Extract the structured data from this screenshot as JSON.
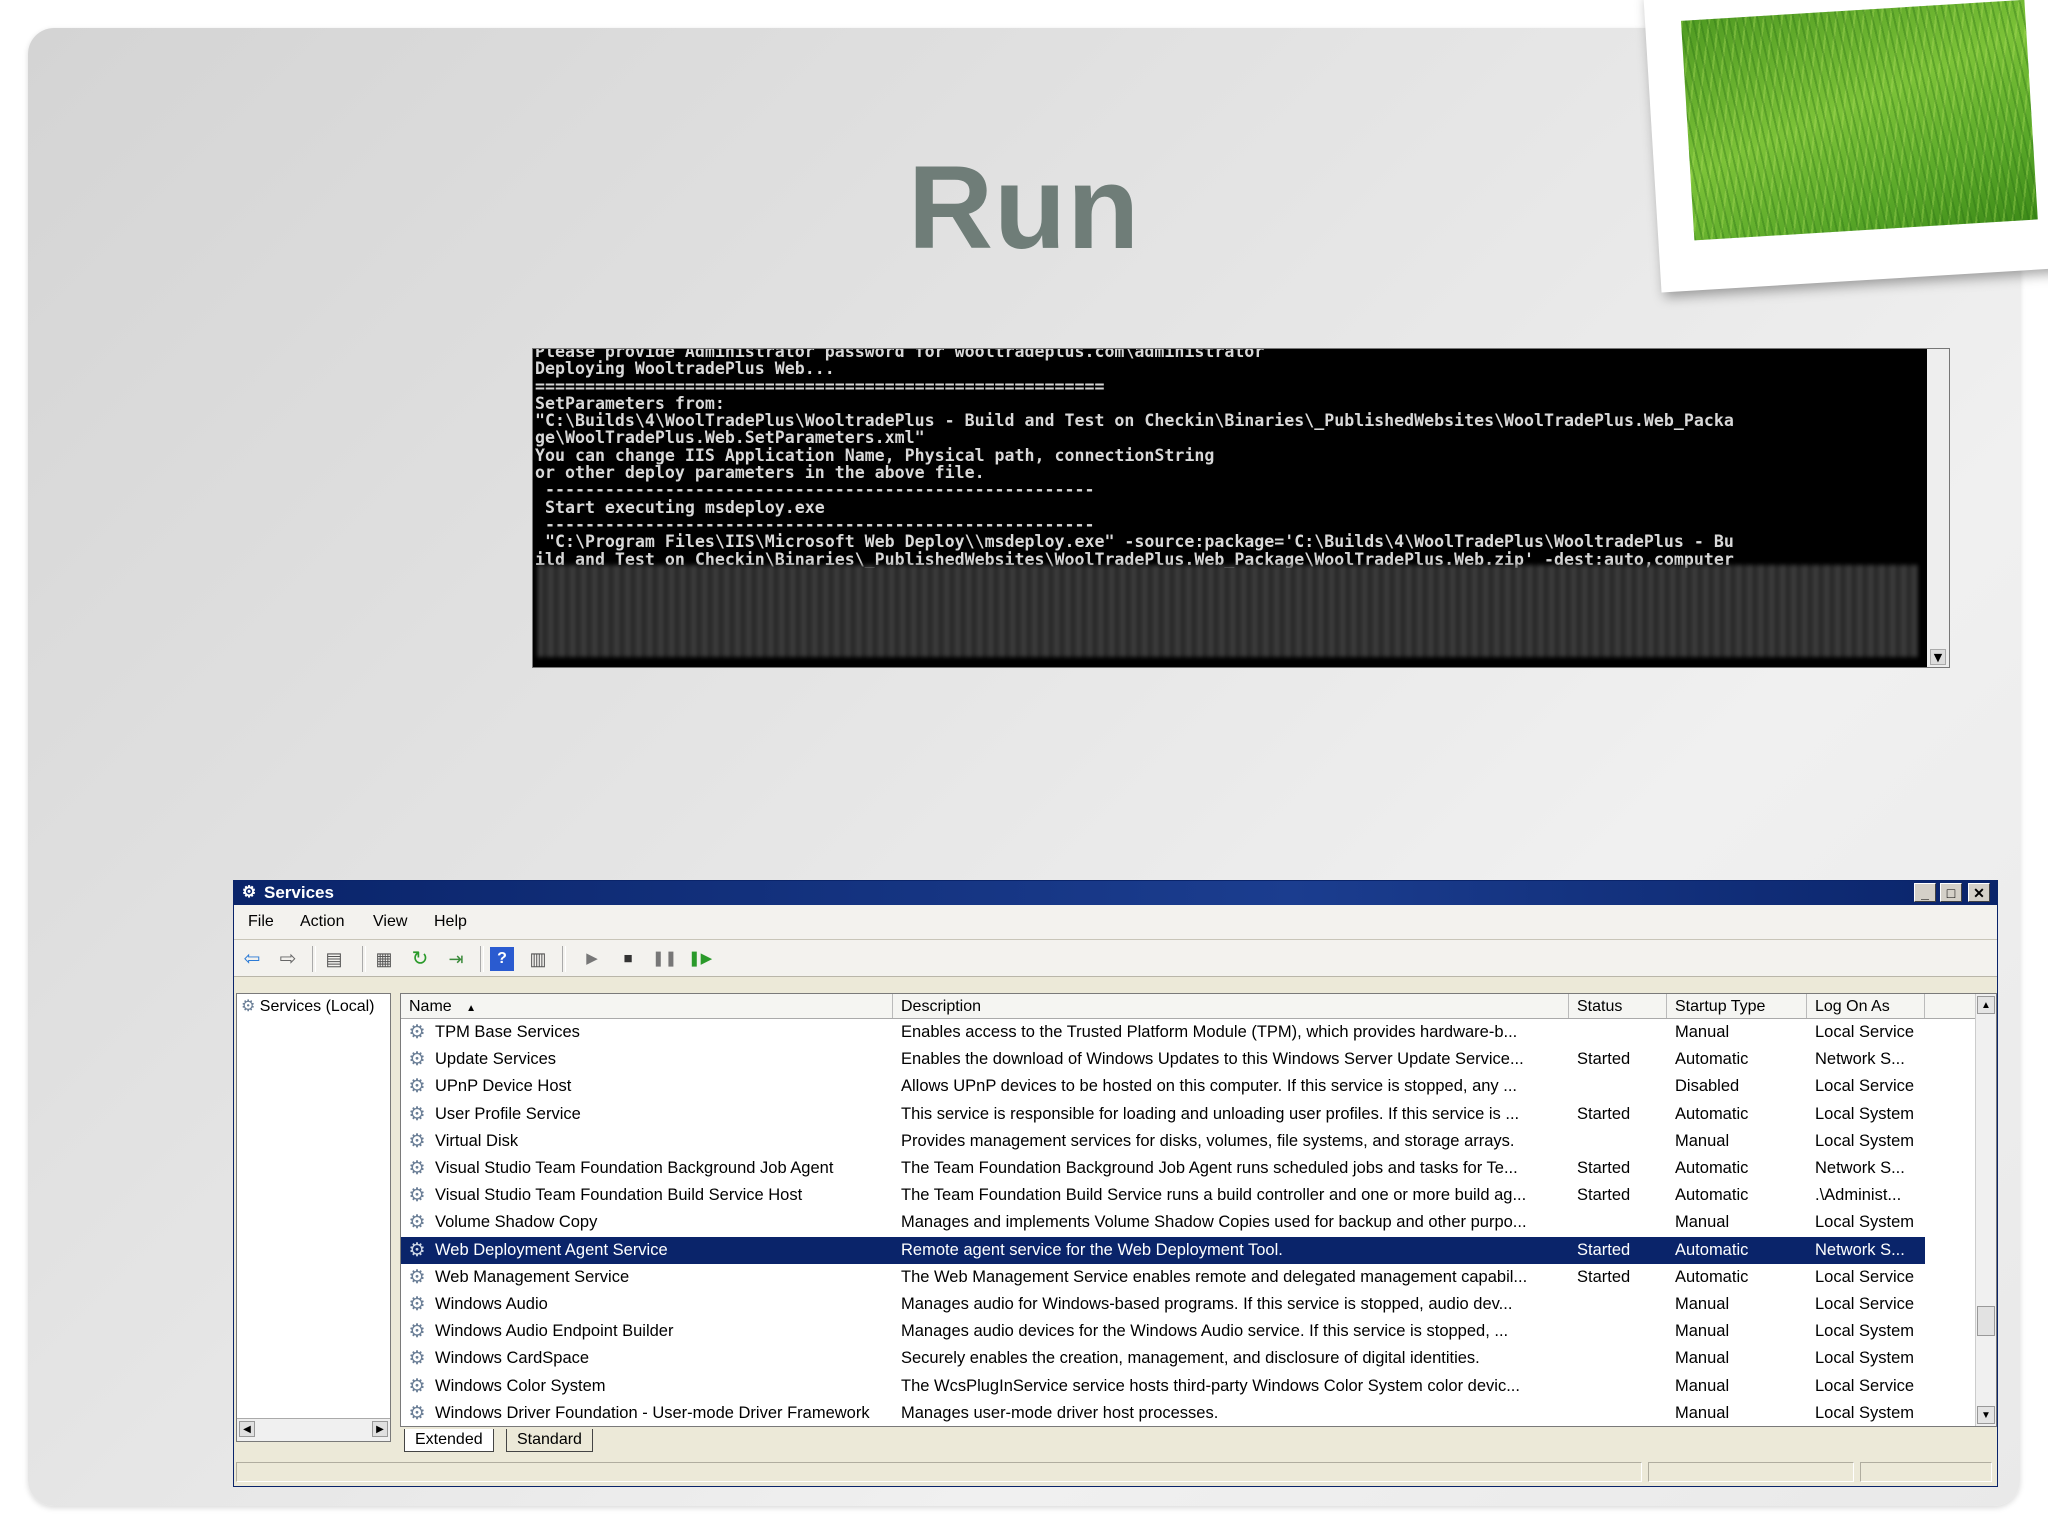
{
  "slide": {
    "title": "Run"
  },
  "console": {
    "lines": [
      "Please provide Administrator password for wooltradeplus.com\\administrator",
      "Deploying WooltradePlus Web...",
      "=========================================================",
      "SetParameters from:",
      "\"C:\\Builds\\4\\WoolTradePlus\\WooltradePlus - Build and Test on Checkin\\Binaries\\_PublishedWebsites\\WoolTradePlus.Web_Packa",
      "ge\\WoolTradePlus.Web.SetParameters.xml\"",
      "You can change IIS Application Name, Physical path, connectionString",
      "or other deploy parameters in the above file.",
      " -------------------------------------------------------",
      " Start executing msdeploy.exe",
      " -------------------------------------------------------",
      " \"C:\\Program Files\\IIS\\Microsoft Web Deploy\\\\msdeploy.exe\" -source:package='C:\\Builds\\4\\WoolTradePlus\\WooltradePlus - Bu",
      "ild and Test on Checkin\\Binaries\\_PublishedWebsites\\WoolTradePlus.Web_Package\\WoolTradePlus.Web.zip' -dest:auto,computer"
    ]
  },
  "window": {
    "title": "Services",
    "menu": [
      "File",
      "Action",
      "View",
      "Help"
    ],
    "tree_node": "Services (Local)",
    "columns": [
      "Name",
      "Description",
      "Status",
      "Startup Type",
      "Log On As"
    ],
    "rows": [
      {
        "name": "TPM Base Services",
        "desc": "Enables access to the Trusted Platform Module (TPM), which provides hardware-b...",
        "status": "",
        "startup": "Manual",
        "logon": "Local Service"
      },
      {
        "name": "Update Services",
        "desc": "Enables the download of Windows Updates to this Windows Server Update Service...",
        "status": "Started",
        "startup": "Automatic",
        "logon": "Network S..."
      },
      {
        "name": "UPnP Device Host",
        "desc": "Allows UPnP devices to be hosted on this computer. If this service is stopped, any ...",
        "status": "",
        "startup": "Disabled",
        "logon": "Local Service"
      },
      {
        "name": "User Profile Service",
        "desc": "This service is responsible for loading and unloading user profiles. If this service is ...",
        "status": "Started",
        "startup": "Automatic",
        "logon": "Local System"
      },
      {
        "name": "Virtual Disk",
        "desc": "Provides management services for disks, volumes, file systems, and storage arrays.",
        "status": "",
        "startup": "Manual",
        "logon": "Local System"
      },
      {
        "name": "Visual Studio Team Foundation Background Job Agent",
        "desc": "The Team Foundation Background Job Agent runs scheduled jobs and tasks for Te...",
        "status": "Started",
        "startup": "Automatic",
        "logon": "Network S..."
      },
      {
        "name": "Visual Studio Team Foundation Build Service Host",
        "desc": "The Team Foundation Build Service runs a build controller and one or more build ag...",
        "status": "Started",
        "startup": "Automatic",
        "logon": ".\\Administ..."
      },
      {
        "name": "Volume Shadow Copy",
        "desc": "Manages and implements Volume Shadow Copies used for backup and other purpo...",
        "status": "",
        "startup": "Manual",
        "logon": "Local System"
      },
      {
        "name": "Web Deployment Agent Service",
        "desc": "Remote agent service for the Web Deployment Tool.",
        "status": "Started",
        "startup": "Automatic",
        "logon": "Network S..."
      },
      {
        "name": "Web Management Service",
        "desc": "The Web Management Service enables remote and delegated management capabil...",
        "status": "Started",
        "startup": "Automatic",
        "logon": "Local Service"
      },
      {
        "name": "Windows Audio",
        "desc": "Manages audio for Windows-based programs.  If this service is stopped, audio dev...",
        "status": "",
        "startup": "Manual",
        "logon": "Local Service"
      },
      {
        "name": "Windows Audio Endpoint Builder",
        "desc": "Manages audio devices for the Windows Audio service.  If this service is stopped, ...",
        "status": "",
        "startup": "Manual",
        "logon": "Local System"
      },
      {
        "name": "Windows CardSpace",
        "desc": "Securely enables the creation, management, and disclosure of digital identities.",
        "status": "",
        "startup": "Manual",
        "logon": "Local System"
      },
      {
        "name": "Windows Color System",
        "desc": "The WcsPlugInService service hosts third-party Windows Color System color devic...",
        "status": "",
        "startup": "Manual",
        "logon": "Local Service"
      },
      {
        "name": "Windows Driver Foundation - User-mode Driver Framework",
        "desc": "Manages user-mode driver host processes.",
        "status": "",
        "startup": "Manual",
        "logon": "Local System"
      }
    ],
    "selected_row_index": 8,
    "tabs": [
      "Extended",
      "Standard"
    ],
    "colors": {
      "title_bar": "#0a246a",
      "selection": "#0a246a"
    },
    "icons": [
      "back-arrow-icon",
      "forward-arrow-icon",
      "show-hide-tree-icon",
      "properties-icon",
      "refresh-icon",
      "export-list-icon",
      "help-icon",
      "show-hide-action-pane-icon",
      "start-service-icon",
      "stop-service-icon",
      "pause-service-icon",
      "resume-service-icon"
    ]
  }
}
